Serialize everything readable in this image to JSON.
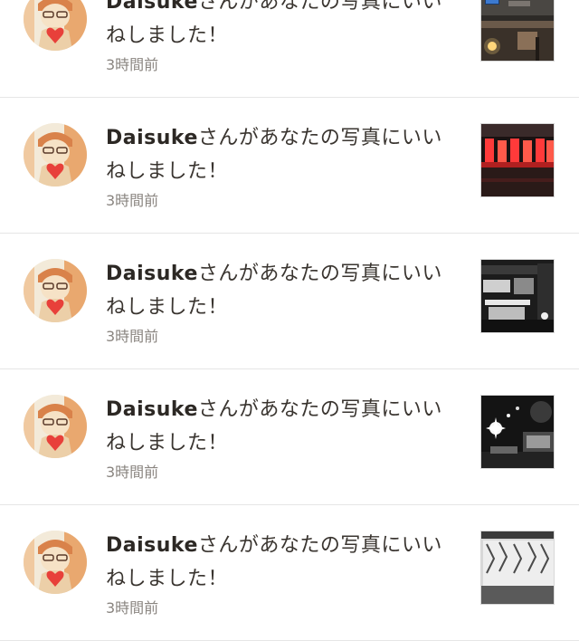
{
  "notifications": [
    {
      "username": "Daisuke",
      "message": "さんがあなたの写真にいいねしました！",
      "message_line1": "さんがあなたの写真にいい",
      "message_line2": "ねしました！",
      "time": "3時間前",
      "avatar_icon": "user-avatar-apple",
      "photo": "photo-cafe-counter"
    },
    {
      "username": "Daisuke",
      "message": "さんがあなたの写真にいいねしました！",
      "message_line1": "さんがあなたの写真にいい",
      "message_line2": "ねしました！",
      "time": "3時間前",
      "avatar_icon": "user-avatar-apple",
      "photo": "photo-red-neon-shelf"
    },
    {
      "username": "Daisuke",
      "message": "さんがあなたの写真にいいねしました！",
      "message_line1": "さんがあなたの写真にいい",
      "message_line2": "ねしました！",
      "time": "3時間前",
      "avatar_icon": "user-avatar-apple",
      "photo": "photo-dark-workspace"
    },
    {
      "username": "Daisuke",
      "message": "さんがあなたの写真にいいねしました！",
      "message_line1": "さんがあなたの写真にいい",
      "message_line2": "ねしました！",
      "time": "3時間前",
      "avatar_icon": "user-avatar-apple",
      "photo": "photo-night-room-lights"
    },
    {
      "username": "Daisuke",
      "message": "さんがあなたの写真にいいねしました！",
      "message_line1": "さんがあなたの写真にいい",
      "message_line2": "ねしました！",
      "time": "3時間前",
      "avatar_icon": "user-avatar-apple",
      "photo": "photo-window-blinds"
    }
  ],
  "colors": {
    "text": "#3a3530",
    "username": "#2c2824",
    "time": "#8a8580",
    "divider": "#e6e6e6",
    "avatar_bg": "#f3ead9",
    "avatar_accent": "#d9824a",
    "heart": "#e8403a"
  }
}
